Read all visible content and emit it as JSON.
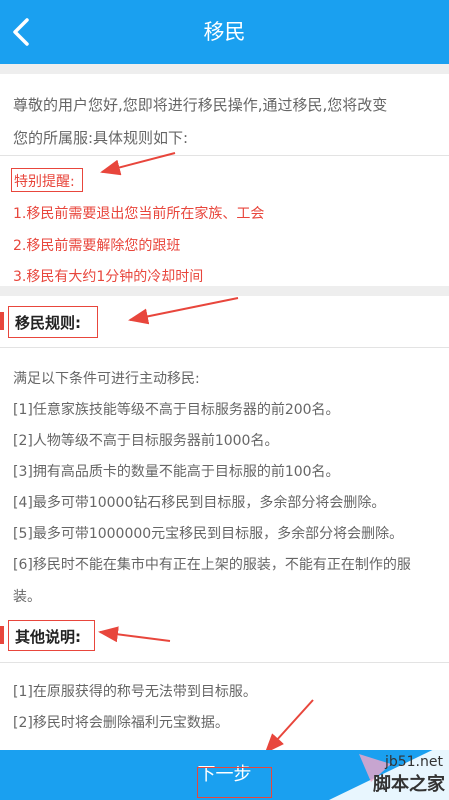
{
  "header": {
    "title": "移民",
    "back_icon": "chevron-left-icon"
  },
  "intro": {
    "line1": "尊敬的用户您好,您即将进行移民操作,通过移民,您将改变",
    "line2": "您的所属服:具体规则如下:"
  },
  "reminder": {
    "title": "特别提醒:",
    "items": [
      "1.移民前需要退出您当前所在家族、工会",
      "2.移民前需要解除您的跟班",
      "3.移民有大约1分钟的冷却时间"
    ]
  },
  "rules": {
    "title": "移民规则:",
    "intro": "满足以下条件可进行主动移民:",
    "items": [
      "[1]任意家族技能等级不高于目标服务器的前200名。",
      "[2]人物等级不高于目标服务器前1000名。",
      "[3]拥有高品质卡的数量不能高于目标服的前100名。",
      "[4]最多可带10000钻石移民到目标服，多余部分将会删除。",
      "[5]最多可带1000000元宝移民到目标服，多余部分将会删除。",
      "[6]移民时不能在集市中有正在上架的服装，不能有正在制作的服",
      "装。"
    ]
  },
  "other": {
    "title": "其他说明:",
    "items": [
      "[1]在原服获得的称号无法带到目标服。",
      "[2]移民时将会删除福利元宝数据。"
    ]
  },
  "footer": {
    "next_label": "下一步"
  },
  "watermark": {
    "site": "jb51.net",
    "name": "脚本之家"
  },
  "colors": {
    "accent": "#1aa0f0",
    "annotation_red": "#e8463c"
  }
}
